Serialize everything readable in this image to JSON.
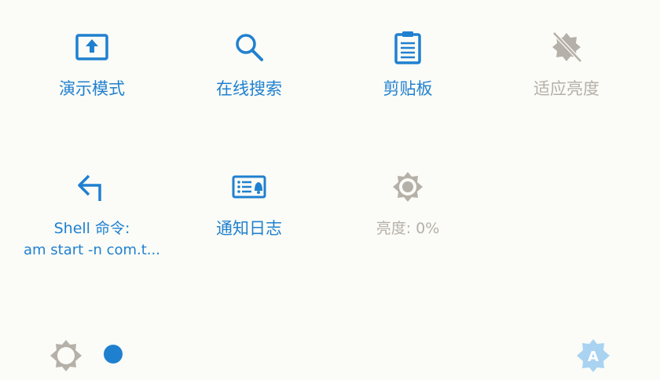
{
  "colors": {
    "active": "#2080d0",
    "inactive": "#b5b0a8",
    "background": "#fbfcf7",
    "auto_badge": "#a9d3f1"
  },
  "tiles": [
    {
      "label": "演示模式",
      "icon": "presentation-icon",
      "state": "active"
    },
    {
      "label": "在线搜索",
      "icon": "search-icon",
      "state": "active"
    },
    {
      "label": "剪贴板",
      "icon": "clipboard-icon",
      "state": "active"
    },
    {
      "label": "适应亮度",
      "icon": "adaptive-brightness-off-icon",
      "state": "inactive"
    },
    {
      "label": "Shell 命令:",
      "sublabel": "am start -n com.t...",
      "icon": "back-arrow-icon",
      "state": "active"
    },
    {
      "label": "通知日志",
      "icon": "notification-log-icon",
      "state": "active"
    },
    {
      "label": "亮度: 0%",
      "icon": "brightness-icon",
      "state": "inactive"
    }
  ],
  "bottom_bar": {
    "brightness_slider_value": 0,
    "auto_brightness_label": "A"
  }
}
